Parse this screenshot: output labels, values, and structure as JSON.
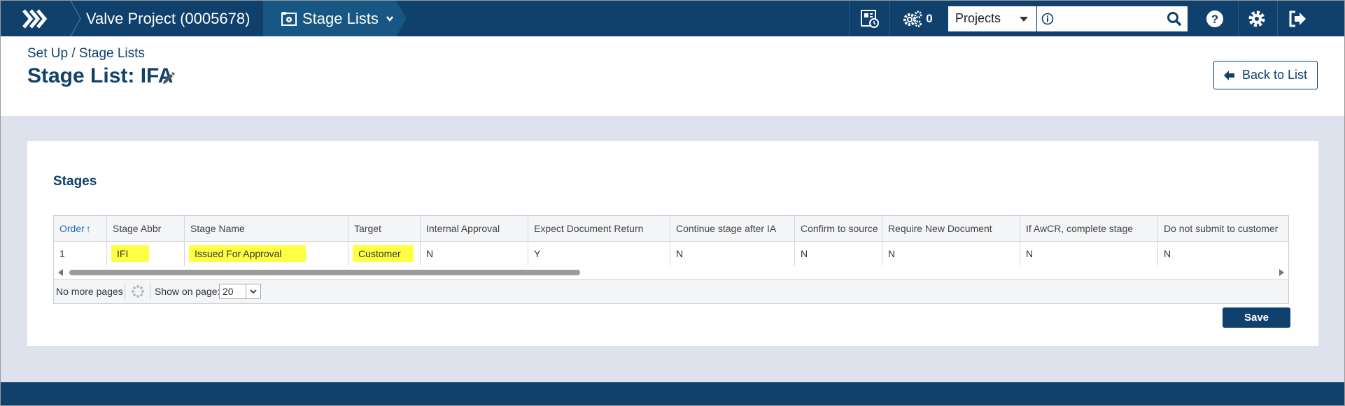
{
  "topbar": {
    "project": "Valve Project (0005678)",
    "module": "Stage Lists",
    "jobs_count": "0",
    "scope_select": "Projects",
    "search_placeholder": ""
  },
  "header": {
    "breadcrumb": "Set Up / Stage Lists",
    "title": "Stage List: IFA",
    "back_label": "Back to List"
  },
  "section": {
    "title": "Stages"
  },
  "grid": {
    "columns": [
      "Order",
      "Stage Abbr",
      "Stage Name",
      "Target",
      "Internal Approval",
      "Expect Document Return",
      "Continue stage after IA",
      "Confirm to source",
      "Require New Document",
      "If AwCR, complete stage",
      "Do not submit to customer"
    ],
    "rows": [
      [
        "1",
        "IFI",
        "Issued For Approval",
        "Customer",
        "N",
        "Y",
        "N",
        "N",
        "N",
        "N",
        "N"
      ]
    ],
    "sort_indicator": "↑"
  },
  "pager": {
    "status": "No more pages",
    "show_label": "Show on page:",
    "page_size": "20"
  },
  "actions": {
    "save_label": "Save"
  },
  "colors": {
    "navy": "#10416c",
    "highlight": "#ffff44",
    "background": "#dde2ec"
  }
}
